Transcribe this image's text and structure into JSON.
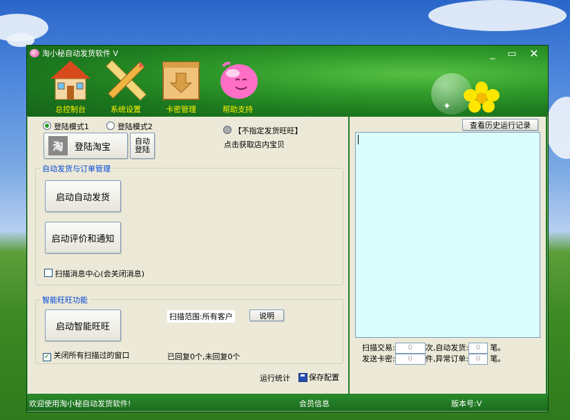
{
  "window": {
    "title": "淘小秘自动发货软件 V"
  },
  "toolbar": {
    "items": [
      {
        "label": "总控制台"
      },
      {
        "label": "系统设置"
      },
      {
        "label": "卡密管理"
      },
      {
        "label": "帮助支持"
      }
    ]
  },
  "login": {
    "mode1": "登陆模式1",
    "mode2": "登陆模式2",
    "login_button": "登陆淘宝",
    "logo_char": "淘",
    "auto_login_line1": "自动",
    "auto_login_line2": "登陆",
    "unspecified_wangwang": "【不指定发货旺旺】",
    "get_items_link": "点击获取店内宝贝"
  },
  "auto_ship": {
    "group_title": "自动发货与订单管理",
    "start_ship": "启动自动发货",
    "start_review": "启动评价和通知",
    "scan_msg_center": "扫描消息中心(会关闭消息)"
  },
  "smart": {
    "group_title": "智能旺旺功能",
    "start_smart": "启动智能旺旺",
    "scan_range": "扫描范围:所有客户",
    "explain": "说明",
    "close_windows": "关闭所有扫描过的窗口",
    "reply_status": "已回复0个,未回复0个"
  },
  "footer_links": {
    "run_stats": "运行统计",
    "save_config": "保存配置"
  },
  "right": {
    "history_button": "查看历史运行记录",
    "scan_trade_label": "扫描交易:",
    "scan_trade_value": "0",
    "times_unit": "次,",
    "auto_ship_label": "自动发货:",
    "auto_ship_value": "0",
    "pen_unit1": "笔。",
    "send_card_label": "发送卡密:",
    "send_card_value": "0",
    "pieces_unit": "件,",
    "abnormal_label": "异常订单:",
    "abnormal_value": "0",
    "pen_unit2": "笔。"
  },
  "status": {
    "welcome": "欢迎使用淘小秘自动发货软件!",
    "member": "会员信息",
    "version": "版本号:V"
  },
  "colors": {
    "window_green": "#1f7a23",
    "log_bg": "#dcfdfd",
    "tool_label": "#fff200"
  }
}
